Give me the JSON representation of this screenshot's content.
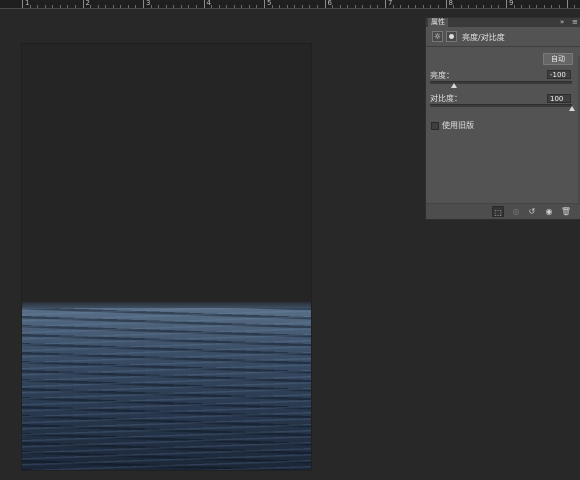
{
  "ruler": {
    "labels": [
      "1",
      "2",
      "3",
      "4",
      "5",
      "6",
      "7",
      "8",
      "9"
    ]
  },
  "canvas": {
    "content": "night sea image"
  },
  "panel": {
    "tab_label": "属性",
    "collapse_icon": "double-chevron-right-icon",
    "menu_icon": "panel-menu-icon",
    "header": {
      "adjustment_icon": "brightness-sun-icon",
      "mask_icon": "layer-mask-icon",
      "title": "亮度/对比度"
    },
    "auto_label": "自动",
    "brightness": {
      "label": "亮度：",
      "value": "-100",
      "level": -100,
      "min": -150,
      "max": 150
    },
    "contrast": {
      "label": "对比度：",
      "value": "100",
      "level": 100,
      "min": -50,
      "max": 100
    },
    "legacy_label": "使用旧版",
    "legacy_checked": false,
    "footer_icons": [
      "clip-to-layer-icon",
      "view-previous-state-icon",
      "reset-icon",
      "visibility-eye-icon",
      "trash-icon"
    ]
  }
}
